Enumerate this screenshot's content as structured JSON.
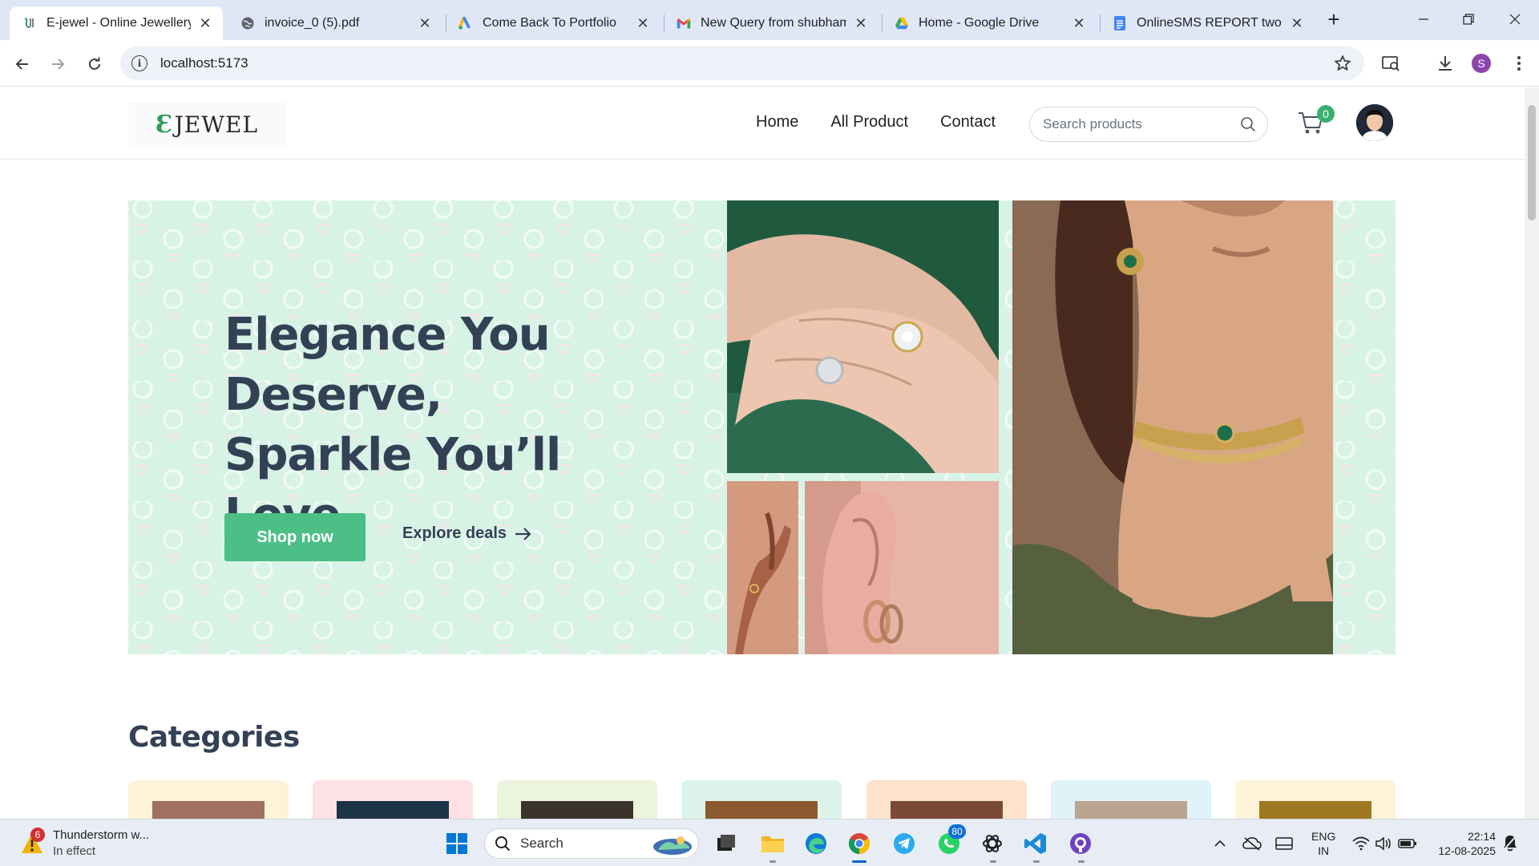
{
  "browser": {
    "tabs": [
      {
        "title": "E-jewel - Online Jewellery sl",
        "icon": "jewel-favicon",
        "active": true
      },
      {
        "title": "invoice_0 (5).pdf",
        "icon": "globe-icon",
        "active": false
      },
      {
        "title": "Come Back To Portfolio",
        "icon": "google-ads-icon",
        "active": false
      },
      {
        "title": "New Query from shubham",
        "icon": "gmail-icon",
        "active": false
      },
      {
        "title": "Home - Google Drive",
        "icon": "google-drive-icon",
        "active": false
      },
      {
        "title": "OnlineSMS REPORT two.do",
        "icon": "google-docs-icon",
        "active": false
      }
    ],
    "close_glyph": "✕",
    "new_tab_glyph": "+",
    "url": "localhost:5173",
    "profile_initial": "S"
  },
  "site": {
    "logo": {
      "mark": "Ɛ",
      "word": "JEWEL"
    },
    "nav": [
      "Home",
      "All Product",
      "Contact"
    ],
    "search_placeholder": "Search products",
    "cart_count": "0",
    "hero": {
      "title": "Elegance You Deserve, Sparkle You’ll Love.",
      "primary_button": "Shop now",
      "secondary_link": "Explore deals"
    },
    "categories_heading": "Categories",
    "category_card_colors": [
      "#fdf3d8",
      "#fde1e4",
      "#edf4dd",
      "#ddf3ea",
      "#fde3cb",
      "#dff3f8",
      "#fdf3d8"
    ],
    "accent_color": "#4bbf86",
    "hero_bg_color": "#d7f3e6"
  },
  "taskbar": {
    "weather_badge": "6",
    "weather_title": "Thunderstorm w...",
    "weather_sub": "In effect",
    "search_label": "Search",
    "whatsapp_badge": "80",
    "lang_line1": "ENG",
    "lang_line2": "IN",
    "time": "22:14",
    "date": "12-08-2025"
  }
}
